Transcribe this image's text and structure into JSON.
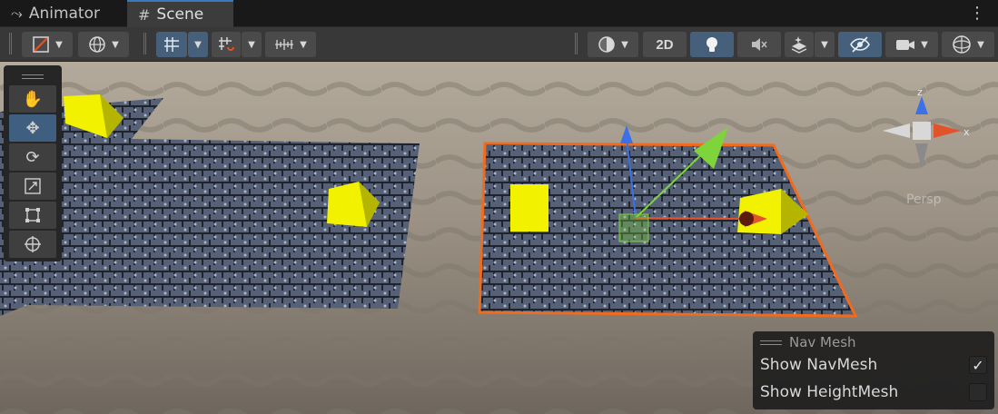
{
  "tabs": [
    {
      "label": "Animator",
      "icon": "animator-icon"
    },
    {
      "label": "Scene",
      "icon": "hash-icon"
    }
  ],
  "toolbar": {
    "view_2d_label": "2D"
  },
  "gizmo": {
    "axis_z": "z",
    "axis_x": "x",
    "projection_label": "Persp"
  },
  "navmesh": {
    "title": "Nav Mesh",
    "options": [
      {
        "label": "Show NavMesh",
        "checked": true
      },
      {
        "label": "Show HeightMesh",
        "checked": false
      }
    ]
  },
  "colors": {
    "selection_outline": "#f26b1d",
    "active_tab_accent": "#3a79bb",
    "tool_selected": "#3f5f80",
    "cube": "#f2f200"
  }
}
